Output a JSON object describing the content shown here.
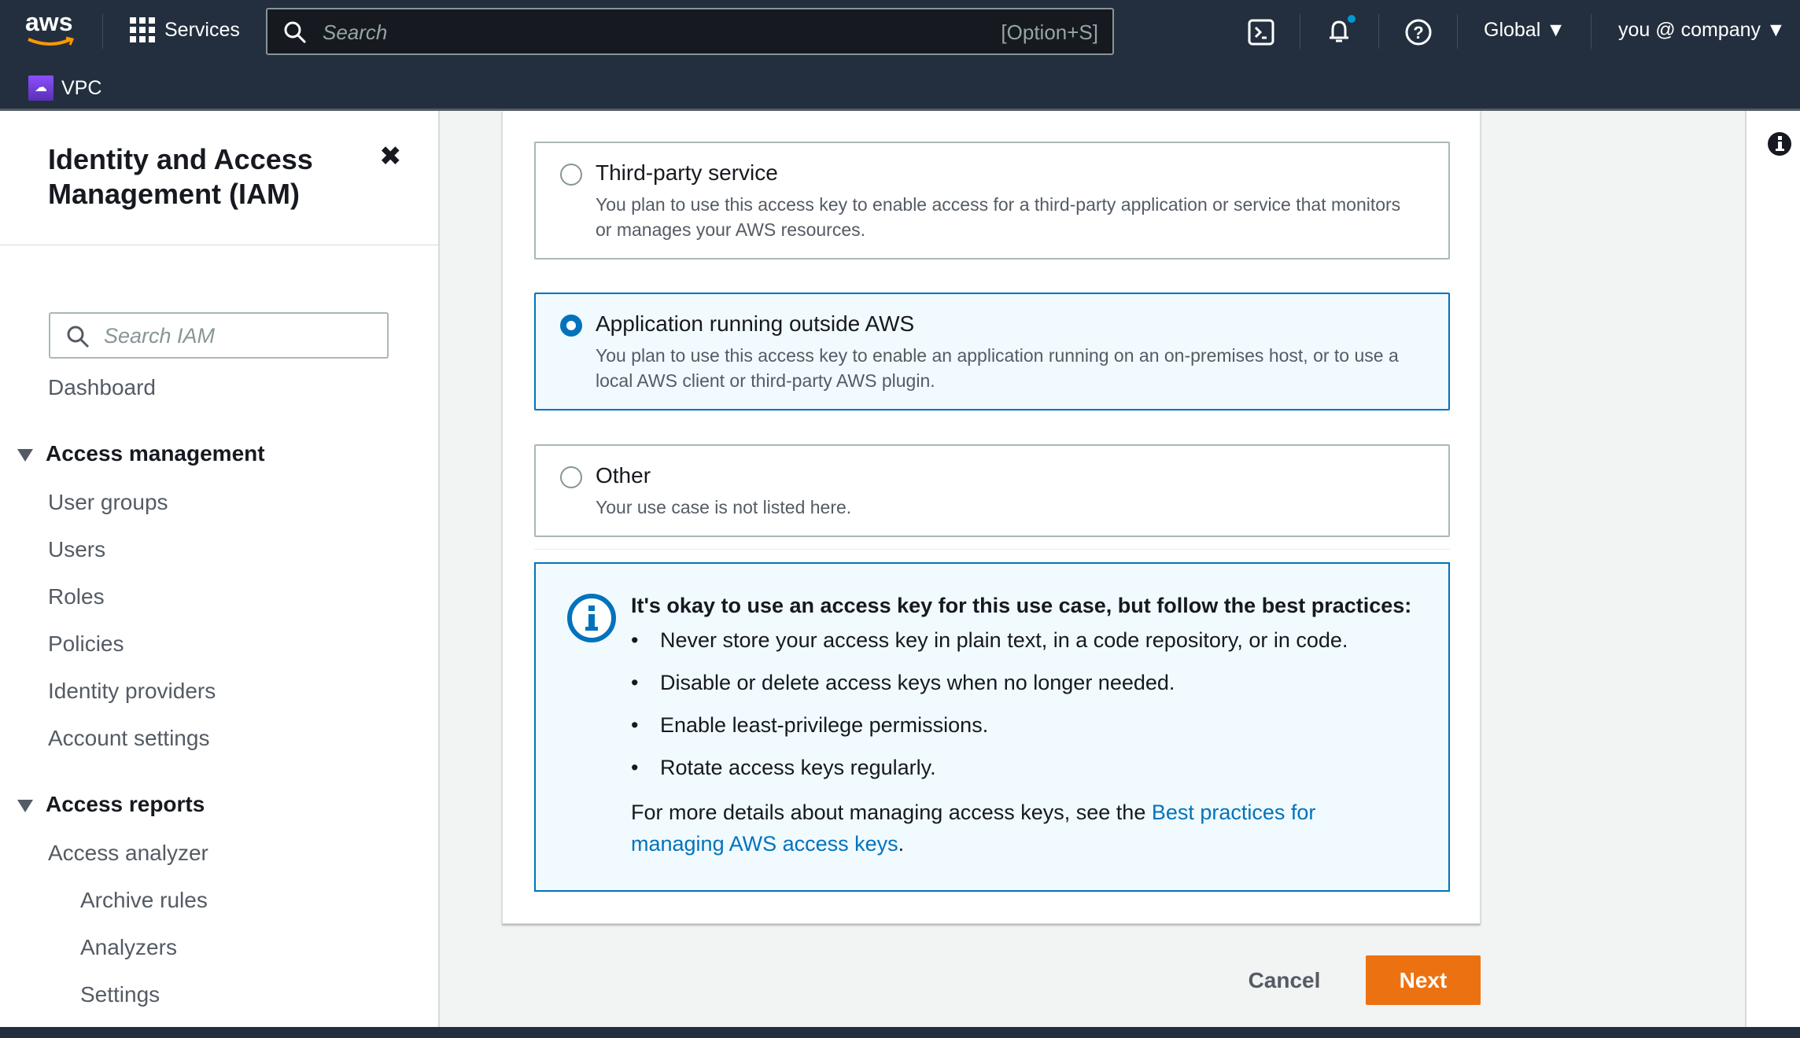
{
  "topnav": {
    "logo": "aws",
    "services": "Services",
    "search_placeholder": "Search",
    "search_shortcut": "[Option+S]",
    "region": "Global",
    "user": "you @ company",
    "service_shortcut": "VPC",
    "notification_dot_color": "#0099d5"
  },
  "sidebar": {
    "title_line1": "Identity and Access",
    "title_line2": "Management (IAM)",
    "search_placeholder": "Search IAM",
    "dashboard": "Dashboard",
    "sections": [
      {
        "label": "Access management",
        "items": [
          "User groups",
          "Users",
          "Roles",
          "Policies",
          "Identity providers",
          "Account settings"
        ]
      },
      {
        "label": "Access reports",
        "items": [
          "Access analyzer"
        ],
        "subitems": [
          "Archive rules",
          "Analyzers",
          "Settings"
        ]
      }
    ]
  },
  "options": [
    {
      "title": "Third-party service",
      "desc": "You plan to use this access key to enable access for a third-party application or service that monitors or manages your AWS resources.",
      "selected": false
    },
    {
      "title": "Application running outside AWS",
      "desc": "You plan to use this access key to enable an application running on an on-premises host, or to use a local AWS client or third-party AWS plugin.",
      "selected": true
    },
    {
      "title": "Other",
      "desc": "Your use case is not listed here.",
      "selected": false
    }
  ],
  "info": {
    "title": "It's okay to use an access key for this use case, but follow the best practices:",
    "bullets": [
      "Never store your access key in plain text, in a code repository, or in code.",
      "Disable or delete access keys when no longer needed.",
      "Enable least-privilege permissions.",
      "Rotate access keys regularly."
    ],
    "more_text": "For more details about managing access keys, see the ",
    "link_line1": "Best practices for",
    "link_line2": "managing AWS access keys",
    "end": "."
  },
  "actions": {
    "cancel": "Cancel",
    "next": "Next"
  },
  "colors": {
    "accent": "#0073bb",
    "primary_button": "#ec7211",
    "header": "#232f3e"
  }
}
